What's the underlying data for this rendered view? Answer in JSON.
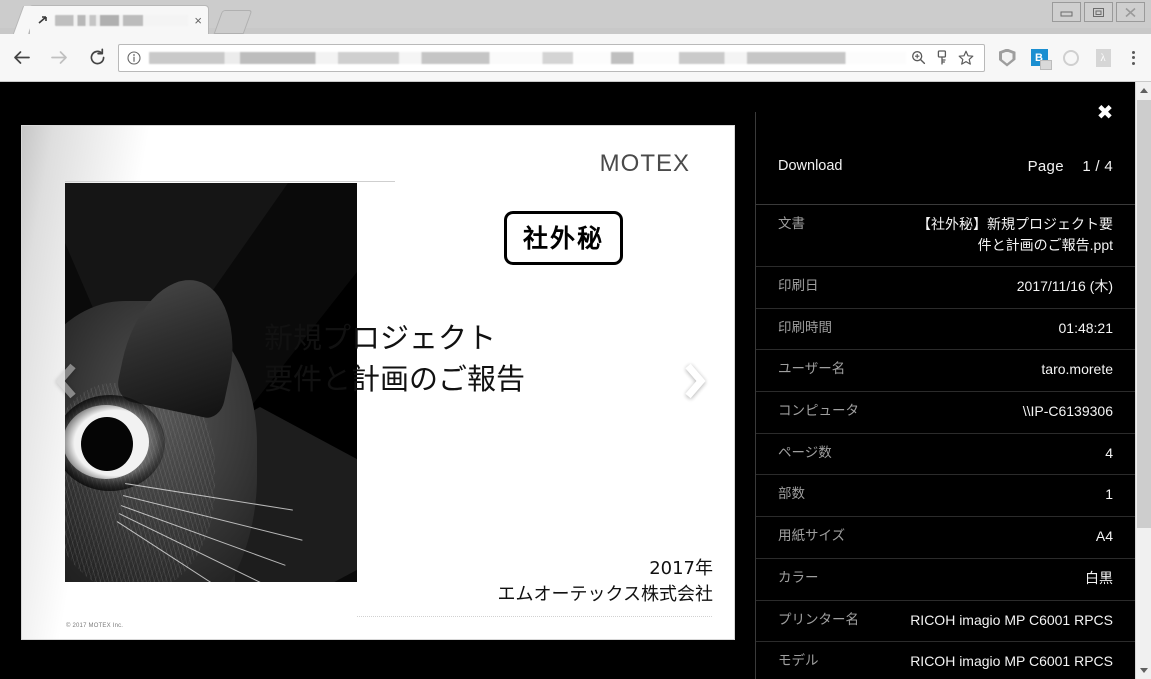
{
  "window": {
    "minimize_label": "minimize",
    "restore_label": "restore",
    "close_label": "close"
  },
  "browser": {
    "tab": {
      "title": "",
      "title_redacted": true,
      "favicon": "arrow-favicon",
      "close_label": "×"
    },
    "new_tab_label": "",
    "back_label": "←",
    "forward_label": "→",
    "reload_label": "⟳",
    "omnibox": {
      "value": "",
      "value_redacted": true,
      "security_icon": "info-circle-icon"
    },
    "actions": [
      "zoom-icon",
      "key-icon",
      "star-icon"
    ],
    "extensions": [
      "shield-icon",
      "blue-b-extension-icon",
      "grey-circle-icon",
      "pdf-icon"
    ],
    "menu_label": "⋮"
  },
  "overlay": {
    "close_label": "✖"
  },
  "slide": {
    "logo": "MOTEX",
    "confidential_badge": "社外秘",
    "title_line1": "新規プロジェクト",
    "title_line2": "要件と計画のご報告",
    "footer_year": "2017年",
    "footer_company": "エムオーテックス株式会社",
    "copyright": "© 2017 MOTEX Inc.",
    "prev_label": "‹",
    "next_label": "›"
  },
  "panel": {
    "download_label": "Download",
    "page_label": "Page",
    "page_value": "1 / 4",
    "rows": [
      {
        "label": "文書",
        "value": "【社外秘】新規プロジェクト要件と計画のご報告.ppt"
      },
      {
        "label": "印刷日",
        "value": "2017/11/16 (木)"
      },
      {
        "label": "印刷時間",
        "value": "01:48:21"
      },
      {
        "label": "ユーザー名",
        "value": "taro.morete"
      },
      {
        "label": "コンピュータ",
        "value": "\\\\IP-C6139306"
      },
      {
        "label": "ページ数",
        "value": "4"
      },
      {
        "label": "部数",
        "value": "1"
      },
      {
        "label": "用紙サイズ",
        "value": "A4"
      },
      {
        "label": "カラー",
        "value": "白黒"
      },
      {
        "label": "プリンター名",
        "value": "RICOH imagio MP C6001 RPCS"
      },
      {
        "label": "モデル",
        "value": "RICOH imagio MP C6001 RPCS"
      }
    ]
  },
  "colors": {
    "page_background": "#000000",
    "panel_text": "#f4f4f4",
    "panel_label": "#9f9f9f",
    "divider": "#2b2b2b",
    "extension_blue": "#1b8fd1",
    "toolbar_background": "#f7f7f7"
  }
}
